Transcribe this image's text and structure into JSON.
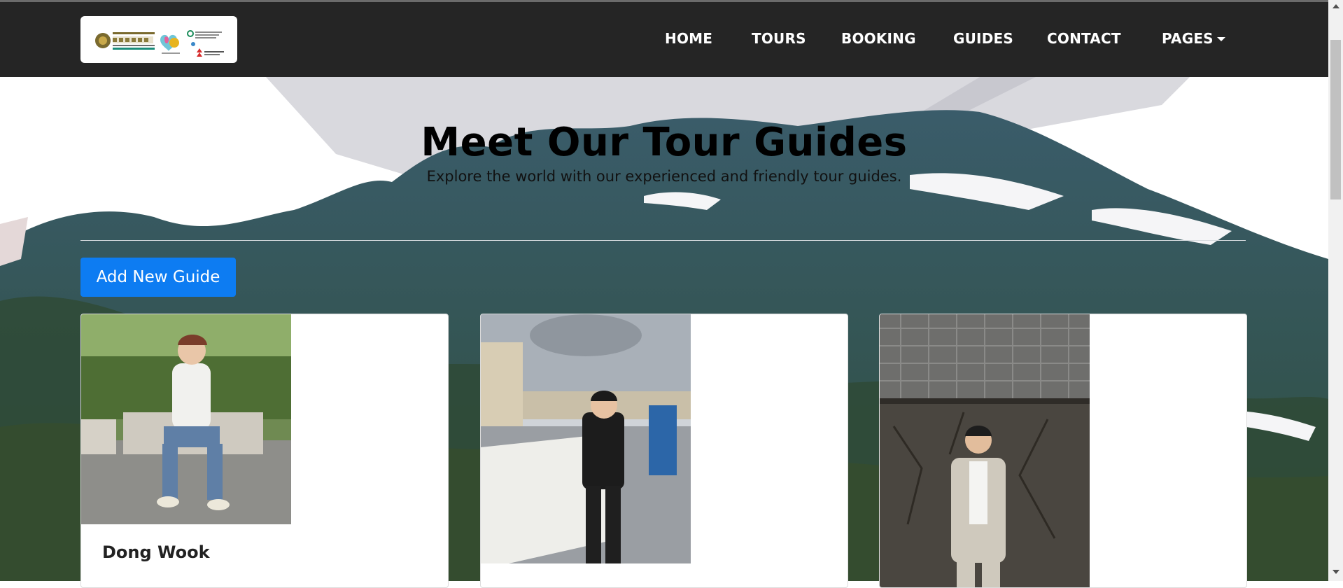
{
  "brand": {
    "logo_alt": "Partner logos"
  },
  "nav": {
    "items": [
      {
        "label": "HOME"
      },
      {
        "label": "TOURS"
      },
      {
        "label": "BOOKING"
      },
      {
        "label": "GUIDES"
      },
      {
        "label": "CONTACT"
      },
      {
        "label": "PAGES"
      }
    ]
  },
  "hero": {
    "title": "Meet Our Tour Guides",
    "subtitle": "Explore the world with our experienced and friendly tour guides."
  },
  "actions": {
    "add_guide": "Add New Guide"
  },
  "guides": [
    {
      "name": "Dong Wook"
    },
    {
      "name": ""
    },
    {
      "name": ""
    }
  ],
  "colors": {
    "navbar": "#252525",
    "primary_button": "#0d7cf2",
    "card_border": "#dcdcdc"
  }
}
